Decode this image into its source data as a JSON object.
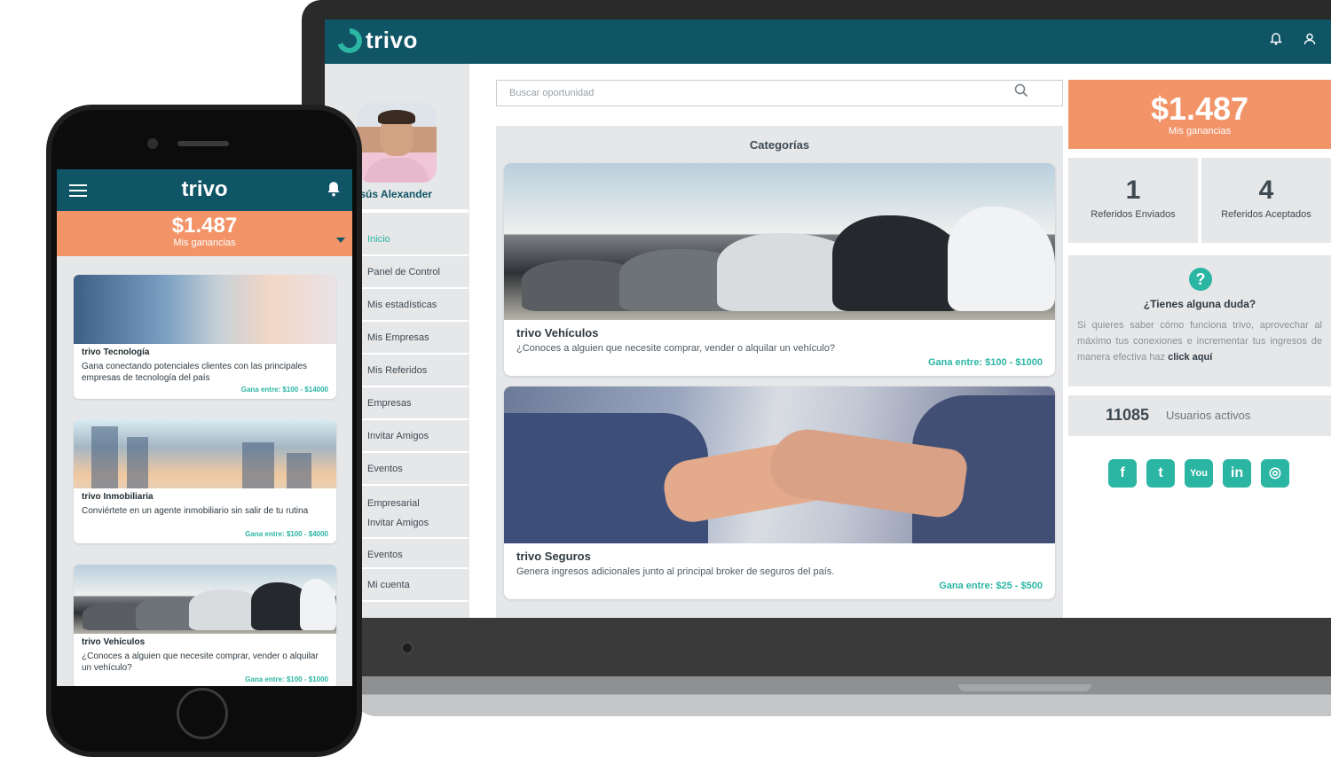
{
  "brand": "trivo",
  "laptop": {
    "search": {
      "placeholder": "Buscar oportunidad"
    },
    "user": {
      "name": "Jesús Alexander"
    },
    "menu": [
      {
        "label": "Inicio",
        "active": true
      },
      {
        "label": "Panel de Control"
      },
      {
        "label": "Mis estadísticas"
      },
      {
        "label": "Mis Empresas"
      },
      {
        "label": "Mis Referidos"
      },
      {
        "label": "Empresas"
      },
      {
        "label": "Invitar Amigos"
      },
      {
        "label": "Eventos"
      },
      {
        "label": "Empresarial"
      },
      {
        "label": "Invitar Amigos"
      },
      {
        "label": "Eventos"
      },
      {
        "label": "Mi cuenta"
      }
    ],
    "categories_title": "Categorías",
    "cards": [
      {
        "title": "trivo Vehículos",
        "desc": "¿Conoces a alguien que necesite comprar, vender o alquilar un vehículo?",
        "earn": "Gana entre: $100 - $1000"
      },
      {
        "title": "trivo Seguros",
        "desc": "Genera ingresos adicionales junto al principal broker de seguros del país.",
        "earn": "Gana entre: $25 - $500"
      }
    ],
    "earnings": {
      "amount": "$1.487",
      "label": "Mis ganancias"
    },
    "stats": [
      {
        "value": "1",
        "label": "Referidos Enviados"
      },
      {
        "value": "4",
        "label": "Referidos Aceptados"
      }
    ],
    "help": {
      "icon": "?",
      "title": "¿Tienes alguna duda?",
      "text": "Si quieres saber cómo funciona trivo, aprovechar al máximo tus conexiones e incrementar tus ingresos de manera efectiva haz",
      "link": "click aquí"
    },
    "users": {
      "count": "11085",
      "label": "Usuarios activos"
    },
    "socials": [
      {
        "name": "facebook-icon",
        "glyph": "f"
      },
      {
        "name": "twitter-icon",
        "glyph": "t"
      },
      {
        "name": "youtube-icon",
        "glyph": "You"
      },
      {
        "name": "linkedin-icon",
        "glyph": "in"
      },
      {
        "name": "instagram-icon",
        "glyph": "◎"
      }
    ]
  },
  "phone": {
    "earnings": {
      "amount": "$1.487",
      "label": "Mis ganancias"
    },
    "cards": [
      {
        "title": "trivo Tecnología",
        "desc": "Gana  conectando potenciales clientes con las principales empresas de tecnología del país",
        "earn": "Gana entre: $100 - $14000"
      },
      {
        "title": "trivo Inmobiliaria",
        "desc": "Conviértete en un agente inmobiliario sin salir de tu rutina",
        "earn": "Gana entre: $100 - $4000"
      },
      {
        "title": "trivo Vehículos",
        "desc": "¿Conoces a alguien que necesite comprar, vender o alquilar un vehículo?",
        "earn": "Gana entre: $100 - $1000"
      }
    ]
  },
  "colors": {
    "primary": "#0f5566",
    "accent": "#2bb5a3",
    "earnings": "#f29468",
    "panel": "#e6e7e9"
  }
}
